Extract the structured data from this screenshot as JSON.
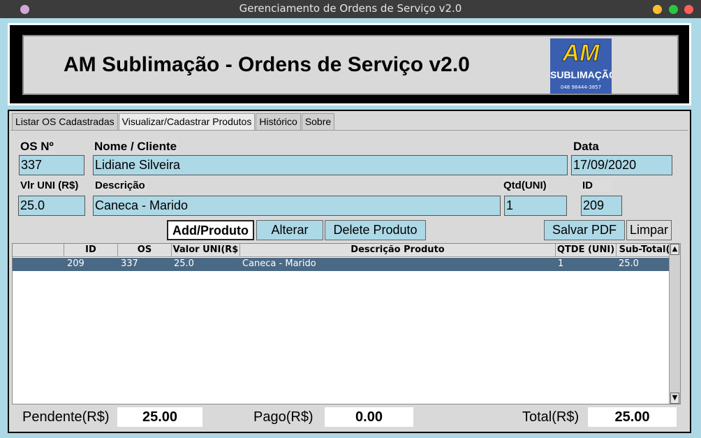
{
  "window": {
    "title": "Gerenciamento de Ordens de Serviço v2.0"
  },
  "header": {
    "app_title": "AM Sublimação - Ordens de Serviço v2.0",
    "logo": {
      "main": "AM",
      "sub": "SUBLIMAÇÃO",
      "phone": "048 98444-3857"
    }
  },
  "tabs": [
    {
      "label": "Listar OS Cadastradas",
      "active": false
    },
    {
      "label": "Visualizar/Cadastrar Produtos",
      "active": true
    },
    {
      "label": "Histórico",
      "active": false
    },
    {
      "label": "Sobre",
      "active": false
    }
  ],
  "form": {
    "os_label": "OS Nº",
    "os_value": "337",
    "cliente_label": "Nome / Cliente",
    "cliente_value": "Lidiane Silveira",
    "data_label": "Data",
    "data_value": "17/09/2020",
    "vlr_label": "Vlr UNI (R$)",
    "vlr_value": "25.0",
    "descricao_label": "Descrição",
    "descricao_value": "Caneca - Marido",
    "qtd_label": "Qtd(UNI)",
    "qtd_value": "1",
    "id_label": "ID",
    "id_value": "209"
  },
  "buttons": {
    "add": "Add/Produto",
    "alterar": "Alterar",
    "delete": "Delete Produto",
    "pdf": "Salvar PDF",
    "limpar": "Limpar"
  },
  "table": {
    "columns": [
      "ID",
      "OS",
      "Valor UNI(R$",
      "Descrição Produto",
      "QTDE (UNI)",
      "Sub-Total(R"
    ],
    "rows": [
      {
        "id": "209",
        "os": "337",
        "valor": "25.0",
        "descricao": "Caneca - Marido",
        "qtde": "1",
        "subtotal": "25.0"
      }
    ]
  },
  "totals": {
    "pendente_label": "Pendente(R$)",
    "pendente_value": "25.00",
    "pago_label": "Pago(R$)",
    "pago_value": "0.00",
    "total_label": "Total(R$)",
    "total_value": "25.00"
  },
  "colors": {
    "background": "#add8e6",
    "selected_row": "#4a6984",
    "window_close": "#ff5f57",
    "window_min": "#febc2e",
    "window_max": "#28c840"
  }
}
